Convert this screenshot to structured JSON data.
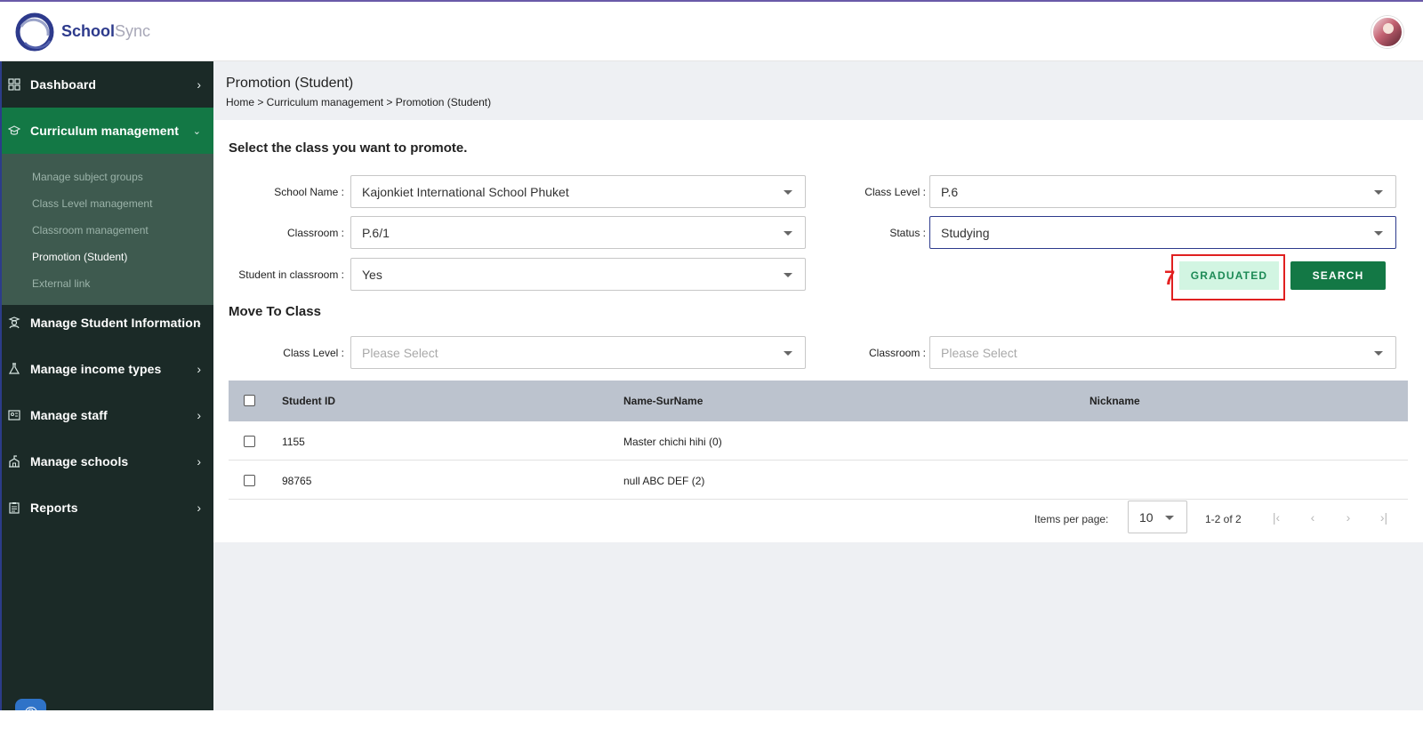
{
  "app": {
    "brand_primary": "School",
    "brand_secondary": "Sync",
    "accent_color": "#137845",
    "sidebar_color": "#1b2a27"
  },
  "sidebar": {
    "items": [
      {
        "label": "Dashboard",
        "icon": "grid-icon"
      },
      {
        "label": "Curriculum management",
        "icon": "graduation-cap-icon"
      },
      {
        "label": "Manage Student Information",
        "icon": "student-icon"
      },
      {
        "label": "Manage income types",
        "icon": "flask-icon"
      },
      {
        "label": "Manage staff",
        "icon": "id-card-icon"
      },
      {
        "label": "Manage schools",
        "icon": "school-icon"
      },
      {
        "label": "Reports",
        "icon": "clipboard-icon"
      }
    ],
    "submenu": [
      "Manage subject groups",
      "Class Level management",
      "Classroom management",
      "Promotion (Student)",
      "External link"
    ]
  },
  "page": {
    "title": "Promotion (Student)",
    "breadcrumb": "Home > Curriculum management > Promotion (Student)"
  },
  "filters": {
    "section_title": "Select the class you want to promote.",
    "school_name_label": "School Name :",
    "school_name_value": "Kajonkiet International School Phuket",
    "class_level_label": "Class Level :",
    "class_level_value": "P.6",
    "classroom_label": "Classroom :",
    "classroom_value": "P.6/1",
    "status_label": "Status :",
    "status_value": "Studying",
    "student_in_classroom_label": "Student in classroom :",
    "student_in_classroom_value": "Yes"
  },
  "actions": {
    "step_number": "7",
    "graduated_label": "GRADUATED",
    "search_label": "SEARCH"
  },
  "move_to": {
    "section_title": "Move To Class",
    "class_level_label": "Class Level :",
    "class_level_placeholder": "Please Select",
    "classroom_label": "Classroom :",
    "classroom_placeholder": "Please Select"
  },
  "table": {
    "columns": [
      "Student ID",
      "Name-SurName",
      "Nickname"
    ],
    "rows": [
      {
        "id": "1155",
        "name": "Master chichi hihi (0)",
        "nickname": ""
      },
      {
        "id": "98765",
        "name": "null ABC DEF (2)",
        "nickname": ""
      }
    ]
  },
  "pagination": {
    "items_per_page_label": "Items per page:",
    "page_size": "10",
    "range": "1-2 of 2"
  }
}
